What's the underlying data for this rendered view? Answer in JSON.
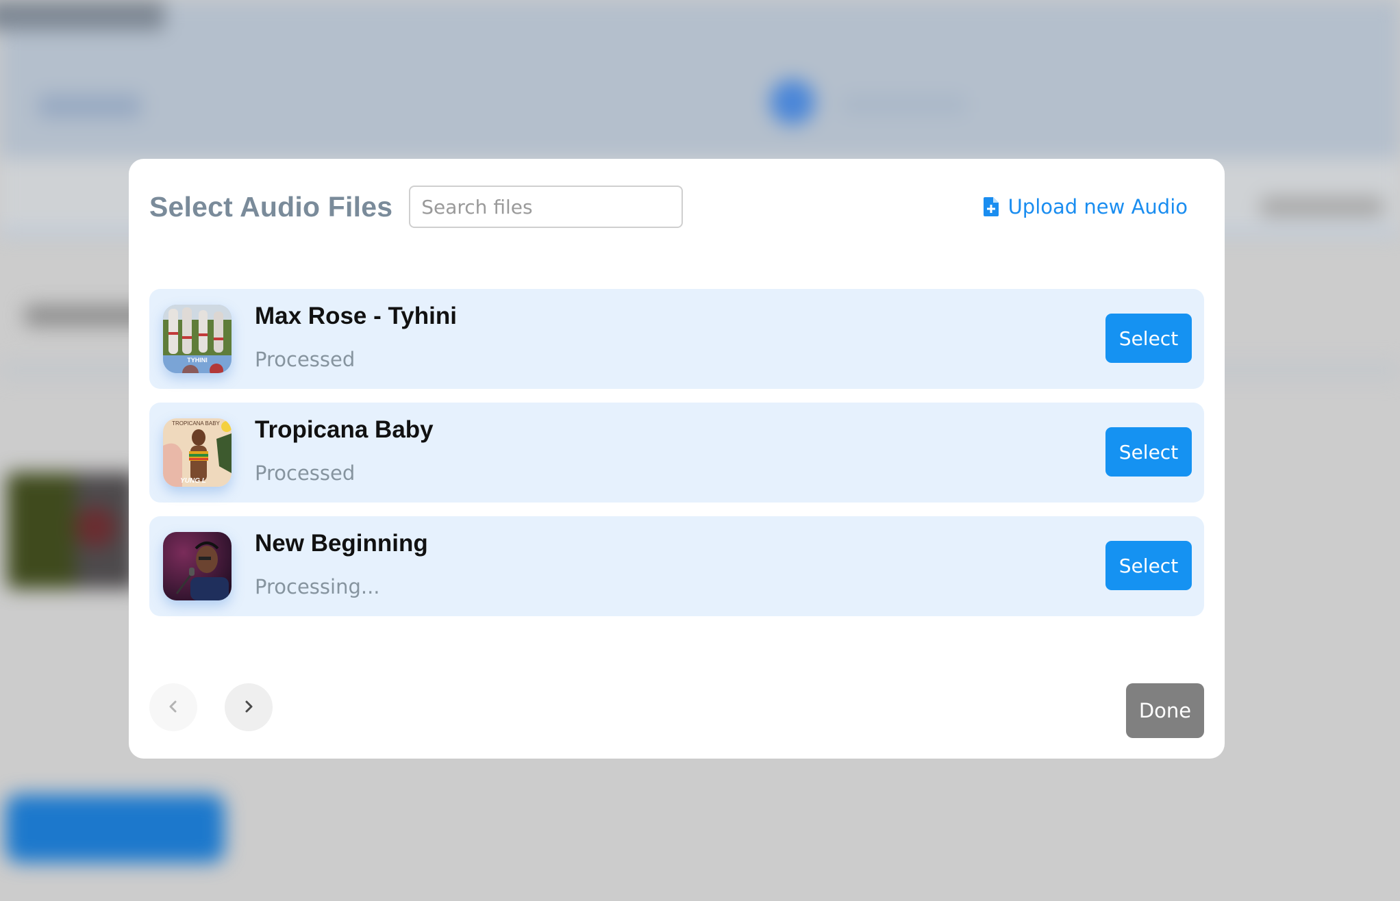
{
  "modal": {
    "title": "Select Audio Files",
    "search": {
      "placeholder": "Search files",
      "value": ""
    },
    "upload_label": "Upload new Audio",
    "upload_icon": "file-plus-icon",
    "files": [
      {
        "title": "Max Rose - Tyhini",
        "status": "Processed",
        "thumbnail_text": "TYHINI",
        "select_label": "Select"
      },
      {
        "title": "Tropicana Baby",
        "status": "Processed",
        "thumbnail_text": "TROPICANA BABY",
        "thumbnail_subtext": "YUNG L",
        "select_label": "Select"
      },
      {
        "title": "New Beginning",
        "status": "Processing...",
        "select_label": "Select"
      }
    ],
    "pagination": {
      "prev_icon": "chevron-left-icon",
      "next_icon": "chevron-right-icon",
      "prev_enabled": false,
      "next_enabled": true
    },
    "done_label": "Done"
  },
  "colors": {
    "accent": "#1592f2",
    "link": "#1a8df0",
    "row_background": "#e6f1fd",
    "title": "#7a8b9a",
    "status_text": "#86949f",
    "done_button": "#808080",
    "overlay": "#cccccc"
  }
}
